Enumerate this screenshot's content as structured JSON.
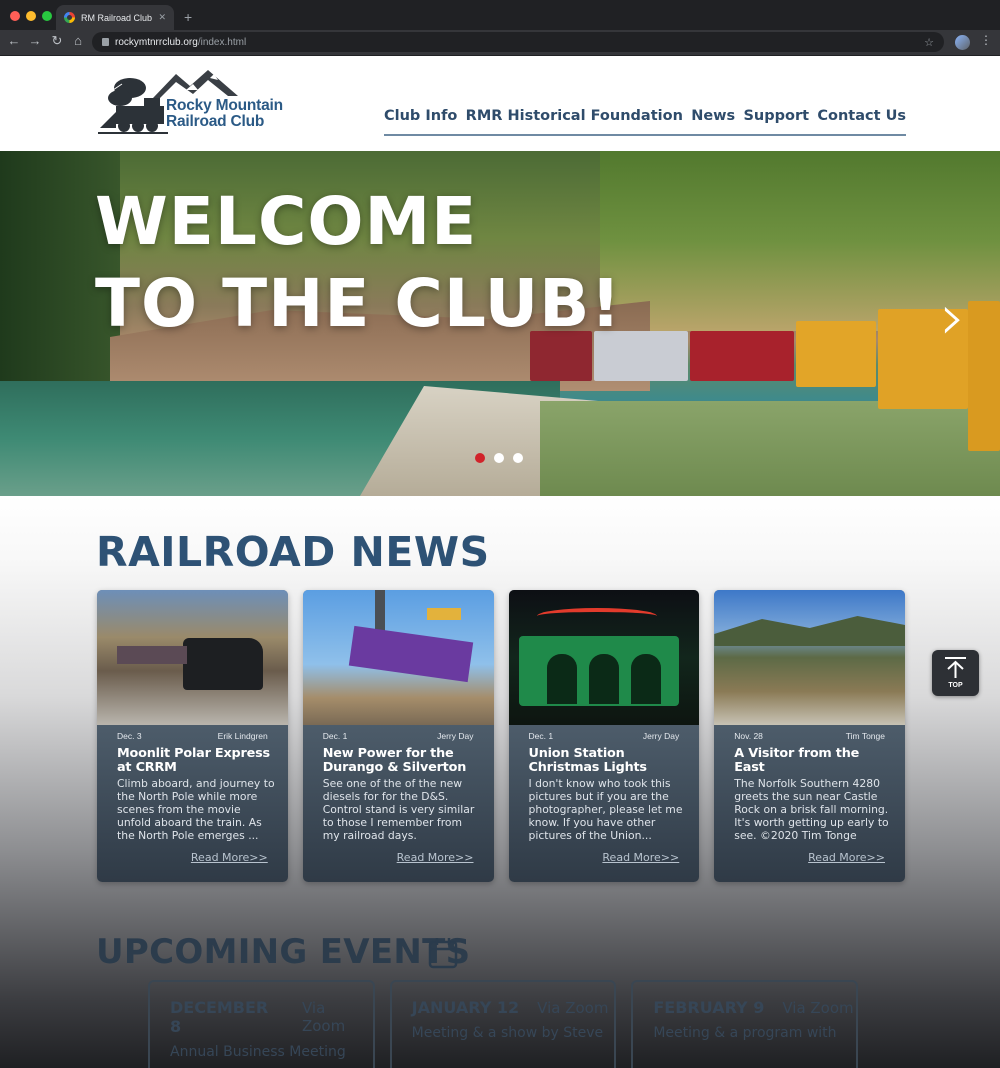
{
  "browser": {
    "tab_title": "RM Railroad Club",
    "url_domain": "rockymtnrrclub.org",
    "url_path": "/index.html"
  },
  "header": {
    "logo_line1": "Rocky Mountain",
    "logo_line2": "Railroad Club",
    "nav": [
      "Club Info",
      "RMR Historical Foundation",
      "News",
      "Support",
      "Contact Us"
    ]
  },
  "hero": {
    "line1": "WELCOME",
    "line2": "TO THE CLUB!",
    "slides": 3,
    "active_slide": 1
  },
  "news": {
    "title": "RAILROAD NEWS",
    "cards": [
      {
        "date": "Dec. 3",
        "author": "Erik Lindgren",
        "title": "Moonlit Polar Express at CRRM",
        "excerpt": "Climb aboard, and journey to the North Pole while more scenes from the movie unfold aboard the train. As the North Pole emerges ...",
        "more": "Read More>>"
      },
      {
        "date": "Dec. 1",
        "author": "Jerry Day",
        "title": "New Power for the Durango & Silverton",
        "excerpt": "See one of the of the new diesels for for the D&S. Control stand is very similar to those I remember from my railroad days.",
        "more": "Read More>>"
      },
      {
        "date": "Dec. 1",
        "author": "Jerry Day",
        "title": "Union Station Christmas Lights",
        "excerpt": "I don't know who took this pictures but if you are the photographer, please let me know. If you have other pictures of the Union...",
        "more": "Read More>>"
      },
      {
        "date": "Nov. 28",
        "author": "Tim Tonge",
        "title": "A Visitor from the East",
        "excerpt": "The Norfolk Southern 4280 greets the sun near Castle Rock on a brisk fall morning. It's worth getting up early to see. ©2020 Tim Tonge",
        "more": "Read More>>"
      }
    ]
  },
  "top_button": {
    "label": "TOP"
  },
  "events": {
    "title": "UPCOMING EVENTS",
    "items": [
      {
        "date": "DECEMBER 8",
        "via": "Via Zoom",
        "desc": "Annual Business Meeting"
      },
      {
        "date": "JANUARY 12",
        "via": "Via Zoom",
        "desc": "Meeting & a show by Steve"
      },
      {
        "date": "FEBRUARY 9",
        "via": "Via Zoom",
        "desc": "Meeting & a program with"
      }
    ]
  },
  "colors": {
    "accent": "#2e5275",
    "indicator_active": "#d1232a"
  }
}
